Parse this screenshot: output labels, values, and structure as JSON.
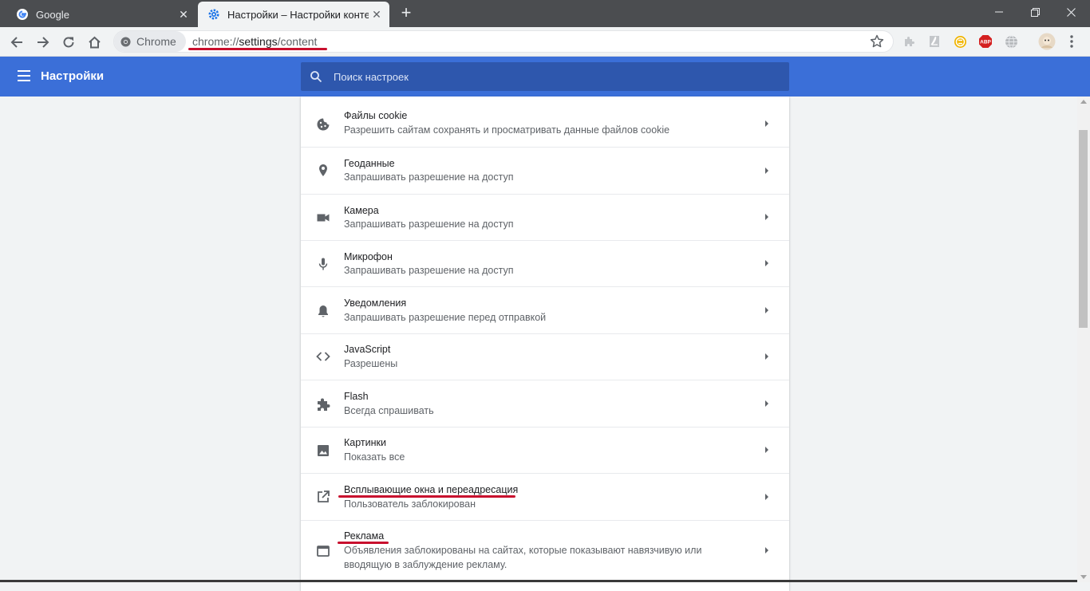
{
  "tabs": [
    {
      "title": "Google",
      "icon": "google-icon",
      "active": false
    },
    {
      "title": "Настройки – Настройки контент",
      "icon": "gear-icon",
      "active": true
    }
  ],
  "address": {
    "chip_label": "Chrome",
    "url_prefix": "chrome://",
    "url_strong": "settings",
    "url_suffix": "/content"
  },
  "extensions": [
    "extension-puzzle-icon",
    "pdf-icon",
    "coin-icon",
    "adblock-abp-icon",
    "globe-icon",
    "profile-avatar-icon"
  ],
  "header": {
    "title": "Настройки",
    "search_placeholder": "Поиск настроек"
  },
  "settings_rows": [
    {
      "icon": "cookie-icon",
      "title": "Файлы cookie",
      "subtitle": "Разрешить сайтам сохранять и просматривать данные файлов cookie"
    },
    {
      "icon": "location-pin-icon",
      "title": "Геоданные",
      "subtitle": "Запрашивать разрешение на доступ"
    },
    {
      "icon": "camera-icon",
      "title": "Камера",
      "subtitle": "Запрашивать разрешение на доступ"
    },
    {
      "icon": "microphone-icon",
      "title": "Микрофон",
      "subtitle": "Запрашивать разрешение на доступ"
    },
    {
      "icon": "bell-icon",
      "title": "Уведомления",
      "subtitle": "Запрашивать разрешение перед отправкой"
    },
    {
      "icon": "code-brackets-icon",
      "title": "JavaScript",
      "subtitle": "Разрешены"
    },
    {
      "icon": "puzzle-piece-icon",
      "title": "Flash",
      "subtitle": "Всегда спрашивать"
    },
    {
      "icon": "image-icon",
      "title": "Картинки",
      "subtitle": "Показать все"
    },
    {
      "icon": "open-in-new-icon",
      "title": "Всплывающие окна и переадресация",
      "subtitle": "Пользователь заблокирован"
    },
    {
      "icon": "window-icon",
      "title": "Реклама",
      "subtitle": "Объявления заблокированы на сайтах, которые показывают навязчивую или вводящую в заблуждение рекламу."
    }
  ],
  "colors": {
    "header_blue": "#3b6fd8",
    "search_blue": "#2e57ad",
    "annotation_red": "#c8102e"
  }
}
